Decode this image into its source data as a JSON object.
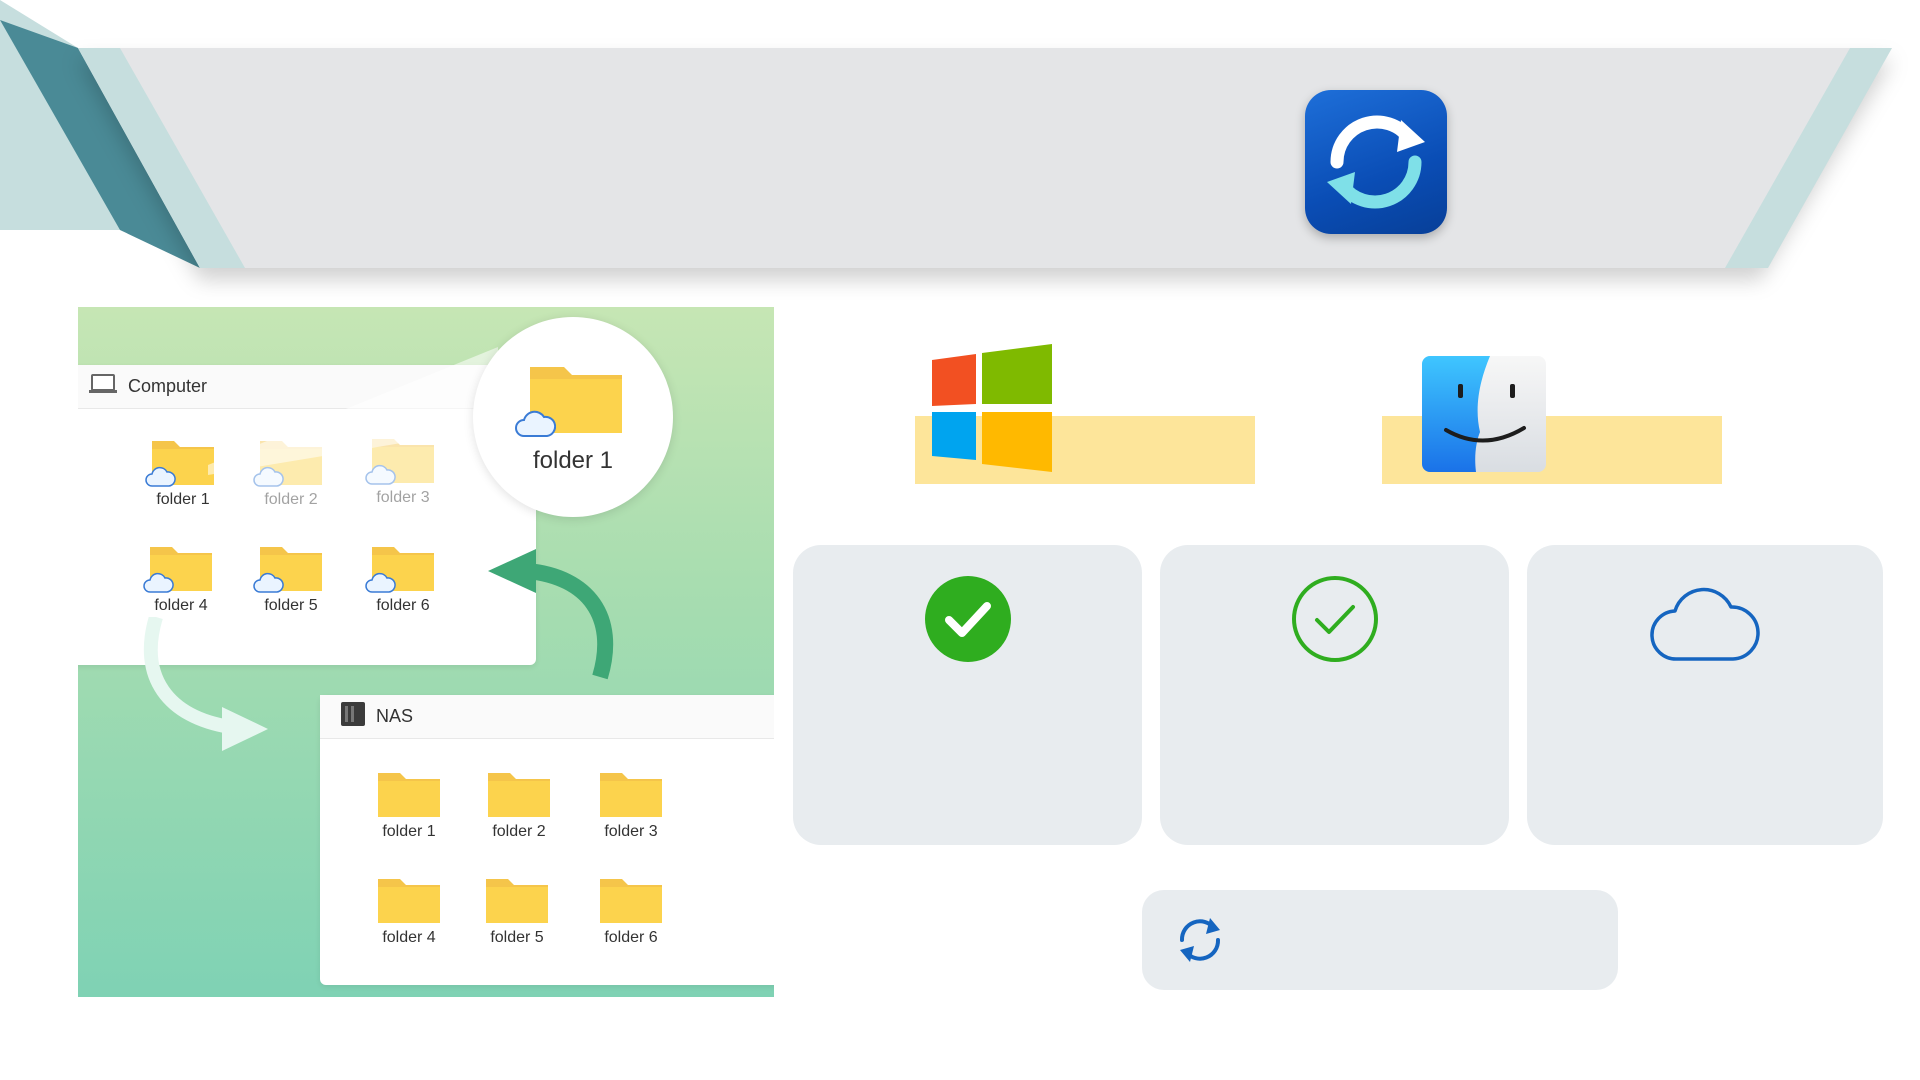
{
  "computer_window": {
    "title": "Computer",
    "folders": [
      "folder 1",
      "folder 2",
      "folder 3",
      "folder 4",
      "folder 5",
      "folder 6"
    ]
  },
  "zoom_callout": {
    "label": "folder 1"
  },
  "nas_window": {
    "title": "NAS",
    "folders": [
      "folder 1",
      "folder 2",
      "folder 3",
      "folder 4",
      "folder 5",
      "folder 6"
    ]
  },
  "icons": {
    "app": "sync-app-icon",
    "windows": "windows-logo-icon",
    "mac": "finder-logo-icon",
    "card1": "check-filled-icon",
    "card2": "check-outline-icon",
    "card3": "cloud-outline-icon",
    "sync": "sync-icon"
  },
  "colors": {
    "accent_blue": "#1565c0",
    "check_green": "#2fad1f",
    "highlight_yellow": "#fde59a",
    "card_gray": "#e8ecef",
    "folder_yellow": "#fcd34d"
  }
}
